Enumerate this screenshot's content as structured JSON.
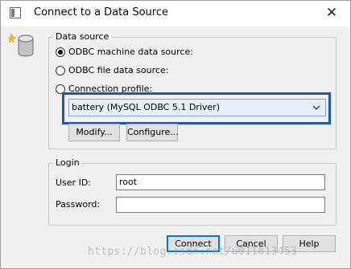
{
  "window": {
    "title": "Connect to a Data Source",
    "close_glyph": "✕"
  },
  "data_source": {
    "group_label": "Data source",
    "options": [
      {
        "label": "ODBC machine data source:",
        "checked": true
      },
      {
        "label": "ODBC file data source:",
        "checked": false
      },
      {
        "label": "Connection profile:",
        "checked": false
      }
    ],
    "selected_value": "battery (MySQL ODBC 5.1 Driver)",
    "modify_label": "Modify...",
    "configure_label": "Configure..."
  },
  "login": {
    "group_label": "Login",
    "user_id_label": "User ID:",
    "user_id_value": "root",
    "password_label": "Password:",
    "password_value": ""
  },
  "buttons": {
    "connect": "Connect",
    "cancel": "Cancel",
    "help": "Help"
  },
  "watermark": "https://blog.csdn.net/u011813453",
  "colors": {
    "highlight": "#1f54b4",
    "select_bg": "#e6f0fa",
    "accent": "#0078d7"
  },
  "icons": {
    "title": "app-window-icon",
    "database": "database-icon",
    "dropdown": "chevron-down-icon"
  }
}
